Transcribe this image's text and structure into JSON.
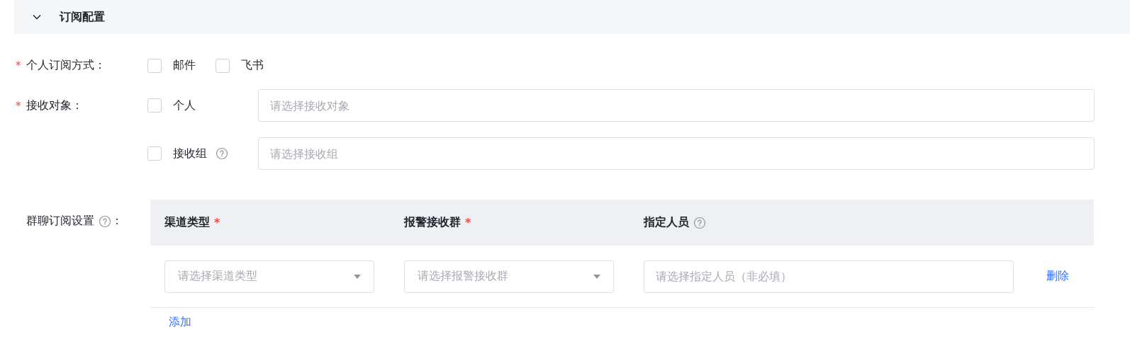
{
  "section": {
    "title": "订阅配置",
    "expanded": true
  },
  "fields": [
    {
      "kind": "checkboxes",
      "required_mark": "*",
      "label": "个人订阅方式",
      "colon": "：",
      "options": [
        {
          "label": "邮件",
          "checked": false
        },
        {
          "label": "飞书",
          "checked": false
        }
      ]
    },
    {
      "kind": "targets",
      "required_mark": "*",
      "label": "接收对象",
      "colon": "：",
      "options": [
        {
          "label": "个人",
          "checked": false,
          "placeholder": "请选择接收对象"
        },
        {
          "label": "接收组",
          "checked": false,
          "help": true,
          "placeholder": "请选择接收组"
        }
      ]
    },
    {
      "kind": "table",
      "label": "群聊订阅设置",
      "colon": "：",
      "help": true,
      "table": {
        "columns": [
          {
            "title": "渠道类型",
            "required_mark": "*"
          },
          {
            "title": "报警接收群",
            "required_mark": "*"
          },
          {
            "title": "指定人员",
            "help": true
          }
        ],
        "rows": [
          {
            "cells": [
              {
                "kind": "select",
                "placeholder": "请选择渠道类型"
              },
              {
                "kind": "select",
                "placeholder": "请选择报警接收群"
              },
              {
                "kind": "input",
                "placeholder": "请选择指定人员（非必填）"
              }
            ],
            "action": "删除"
          }
        ],
        "add": "添加"
      }
    }
  ]
}
